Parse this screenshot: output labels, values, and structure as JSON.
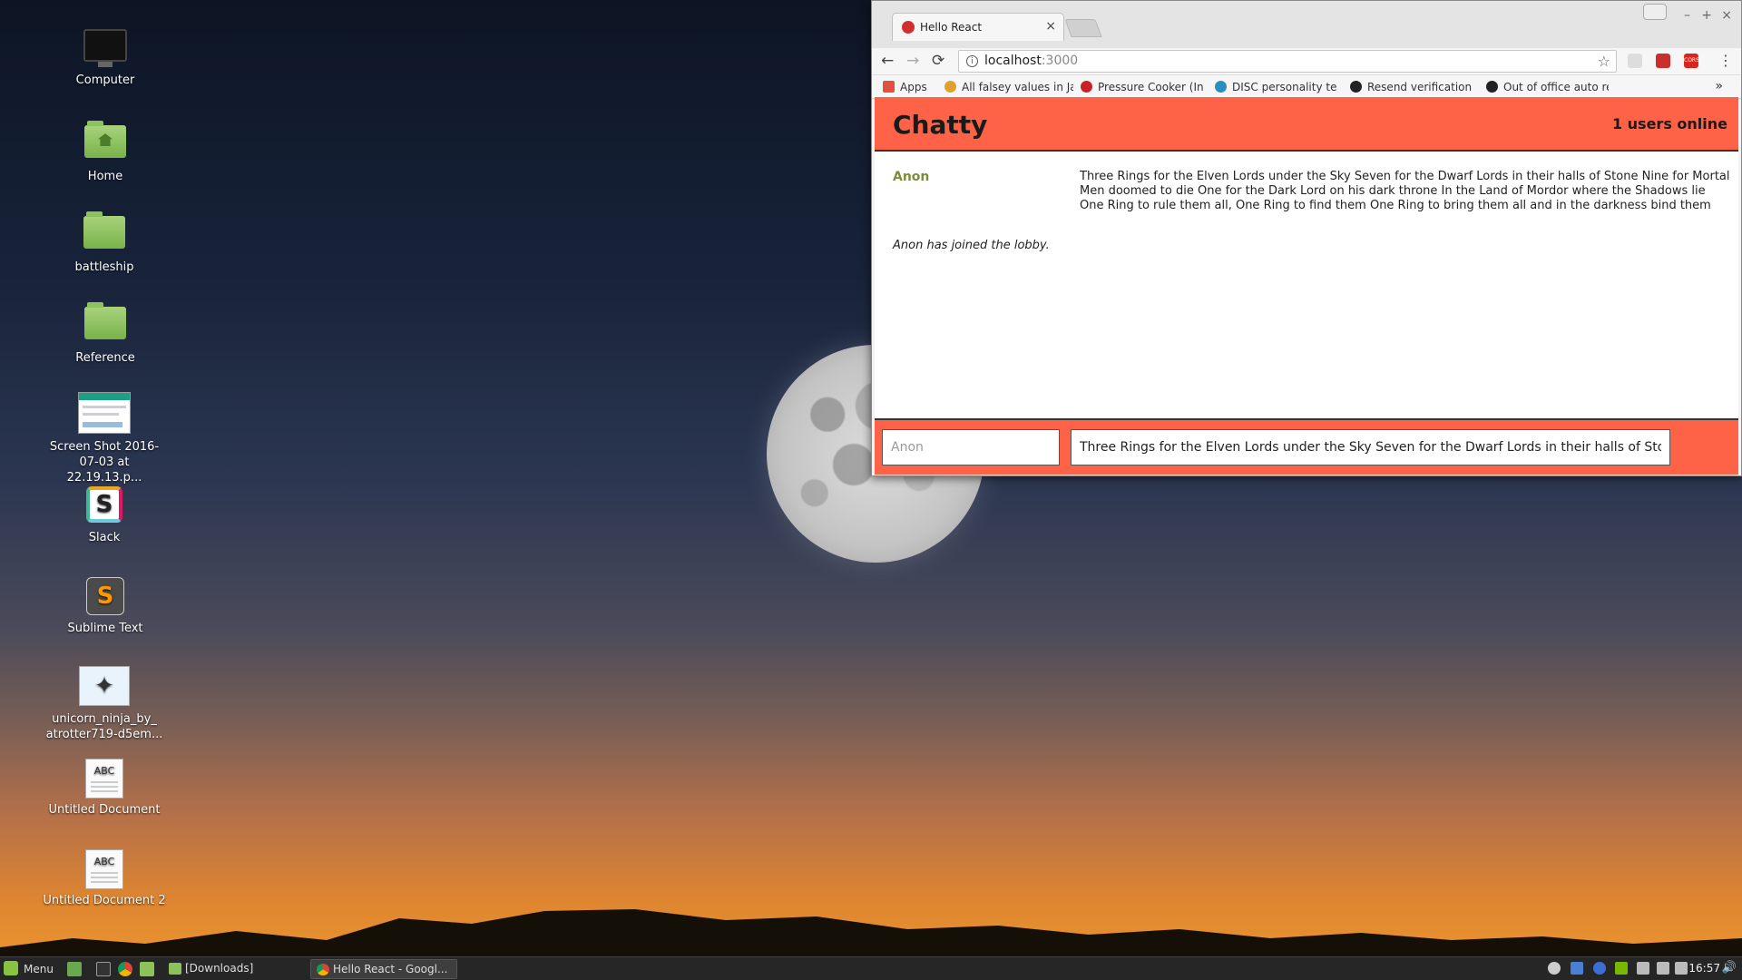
{
  "desktop": {
    "icons": [
      {
        "label": "Computer",
        "icon": "monitor-icon"
      },
      {
        "label": "Home",
        "icon": "home-folder-icon"
      },
      {
        "label": "battleship",
        "icon": "folder-icon"
      },
      {
        "label": "Reference",
        "icon": "folder-icon"
      },
      {
        "label": "Screen Shot 2016-07-03 at 22.19.13.p...",
        "icon": "image-thumbnail-icon"
      },
      {
        "label": "Slack",
        "icon": "slack-icon"
      },
      {
        "label": "Sublime Text",
        "icon": "sublime-text-icon"
      },
      {
        "label": "unicorn_ninja_by_ atrotter719-d5em...",
        "icon": "image-thumbnail-icon"
      },
      {
        "label": "Untitled Document",
        "icon": "text-document-icon"
      },
      {
        "label": "Untitled Document 2",
        "icon": "text-document-icon"
      }
    ],
    "doc_icon_text": "ABC",
    "slack_glyph": "S",
    "sublime_glyph": "S"
  },
  "browser": {
    "tab_title": "Hello React",
    "tab_close": "×",
    "url_host": "localhost",
    "url_port": ":3000",
    "info_glyph": "i",
    "star_glyph": "☆",
    "back_glyph": "←",
    "forward_glyph": "→",
    "reload_glyph": "⟳",
    "menu_glyph": "⋮",
    "window_controls": {
      "minimize": "–",
      "maximize": "+",
      "close": "×"
    },
    "bookmarks": [
      {
        "label": "Apps",
        "icon": "apps-grid-icon"
      },
      {
        "label": "All falsey values in Ja",
        "icon": "bookmark-icon"
      },
      {
        "label": "Pressure Cooker (In",
        "icon": "pinterest-icon"
      },
      {
        "label": "DISC personality tes",
        "icon": "globe-icon"
      },
      {
        "label": "Resend verification",
        "icon": "github-icon"
      },
      {
        "label": "Out of office auto re",
        "icon": "github-icon"
      }
    ],
    "bookmarks_more": "»",
    "ext_cors_label": "CORS"
  },
  "chatty": {
    "title": "Chatty",
    "users_online": "1 users online",
    "messages": [
      {
        "username": "Anon",
        "content": "Three Rings for the Elven Lords under the Sky Seven for the Dwarf Lords in their halls of Stone Nine for Mortal Men doomed to die One for the Dark Lord on his dark throne In the Land of Mordor where the Shadows lie One Ring to rule them all, One Ring to find them One Ring to bring them all and in the darkness bind them"
      }
    ],
    "system_message": "Anon has joined the lobby.",
    "username_input": {
      "placeholder": "Anon",
      "value": ""
    },
    "message_input": {
      "placeholder": "",
      "value": "Three Rings for the Elven Lords under the Sky Seven for the Dwarf Lords in their halls of Stone Nine"
    }
  },
  "taskbar": {
    "menu_label": "Menu",
    "tasks": [
      {
        "label": "[Downloads]",
        "icon": "folder-icon",
        "active": false
      },
      {
        "label": "Hello React - Googl...",
        "icon": "chrome-icon",
        "active": true
      }
    ],
    "clock": "16:57",
    "volume_glyph": "🔊"
  },
  "colors": {
    "chatty_accent": "#ff6347",
    "username_color": "#7a8e3a",
    "taskbar_bg": "#262626",
    "mint_green": "#87c440"
  }
}
